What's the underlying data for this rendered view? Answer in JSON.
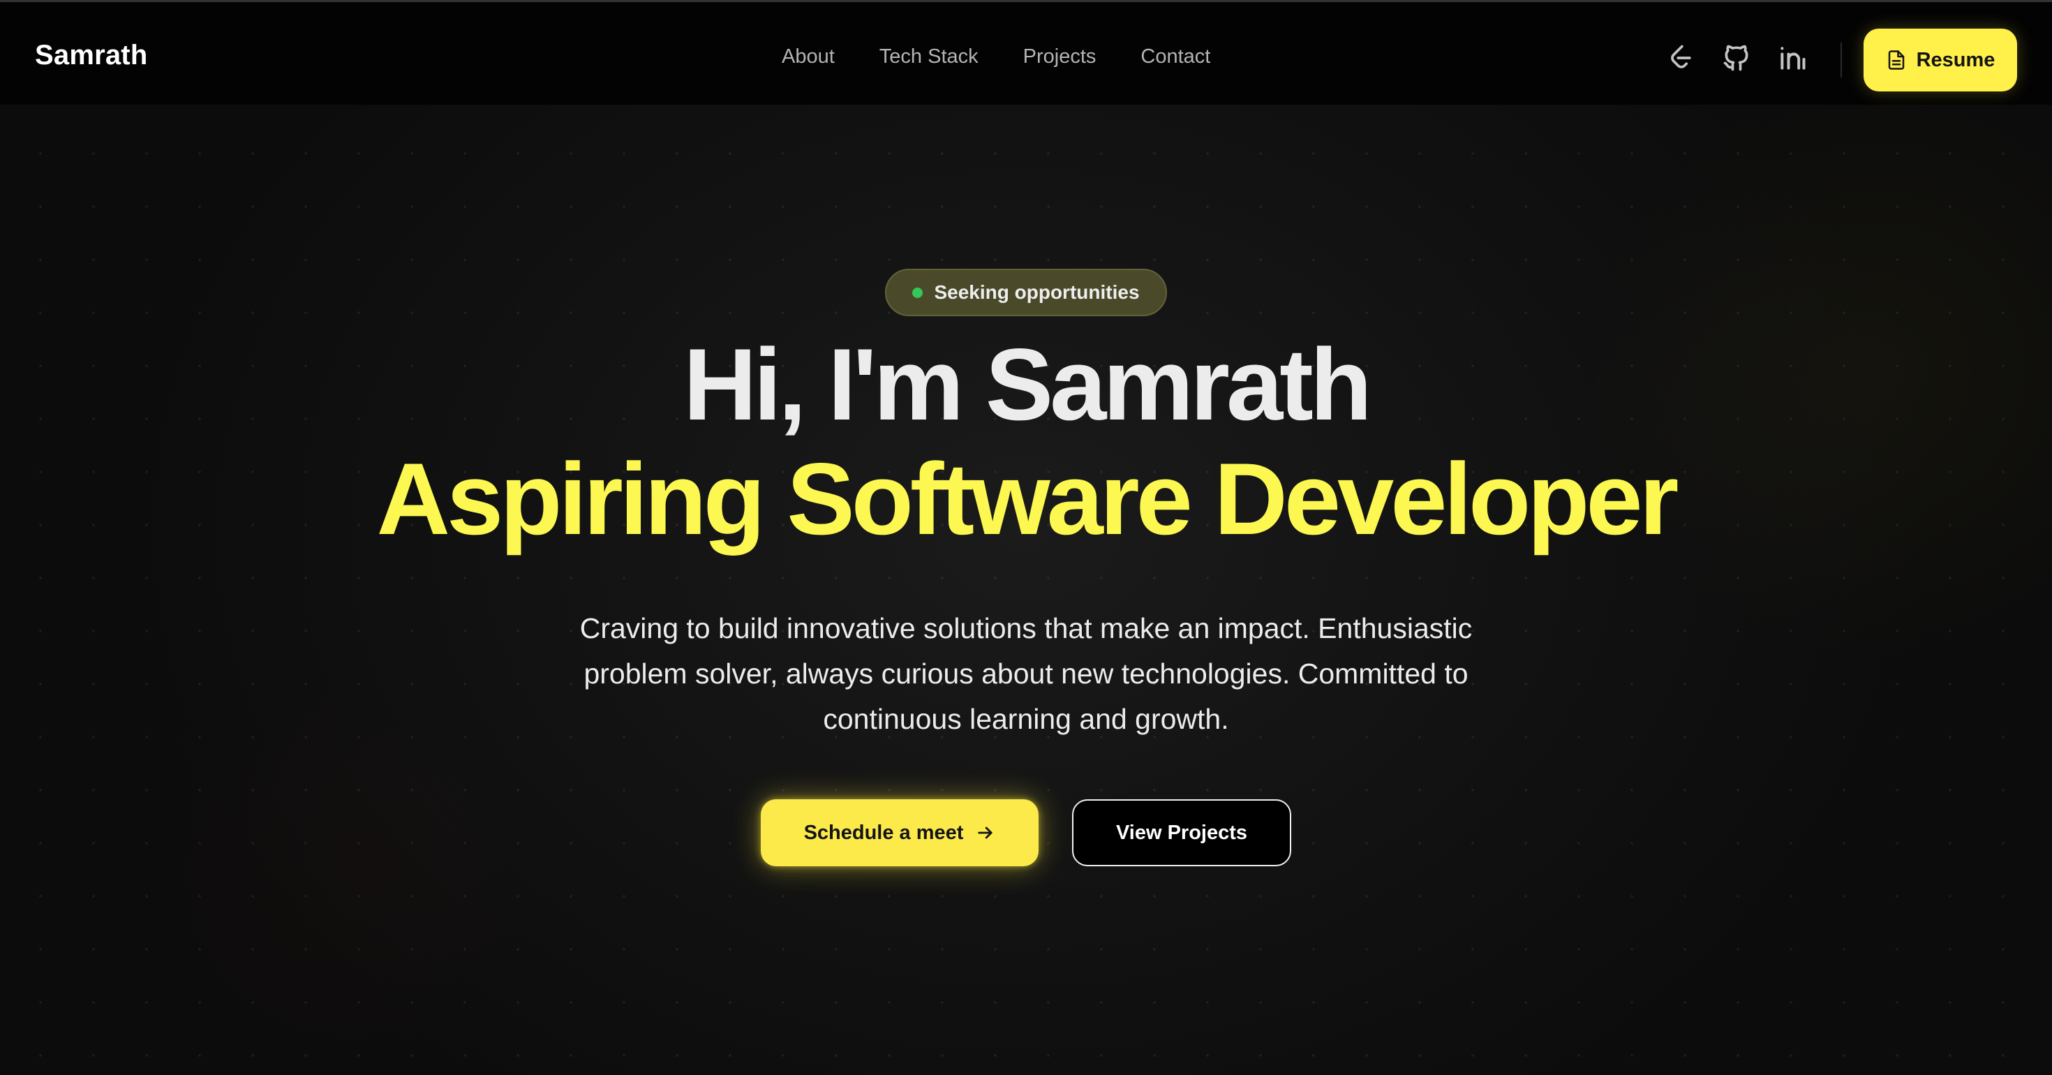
{
  "nav": {
    "brand": "Samrath",
    "links": [
      "About",
      "Tech Stack",
      "Projects",
      "Contact"
    ],
    "social_icons": [
      "leetcode-icon",
      "github-icon",
      "linkedin-icon"
    ],
    "resume_label": "Resume",
    "resume_icon": "document-icon"
  },
  "hero": {
    "badge": "Seeking opportunities",
    "badge_dot_color": "#34c759",
    "headline": "Hi, I'm Samrath",
    "subheadline": "Aspiring Software Developer",
    "intro": "Craving to build innovative solutions that make an impact. Enthusiastic problem solver, always curious about new technologies. Committed to continuous learning and growth.",
    "primary_cta": "Schedule a meet",
    "primary_cta_icon": "arrow-right-icon",
    "secondary_cta": "View Projects"
  },
  "colors": {
    "accent": "#fcf851",
    "background": "#0d0d0d",
    "text": "#ececec"
  }
}
